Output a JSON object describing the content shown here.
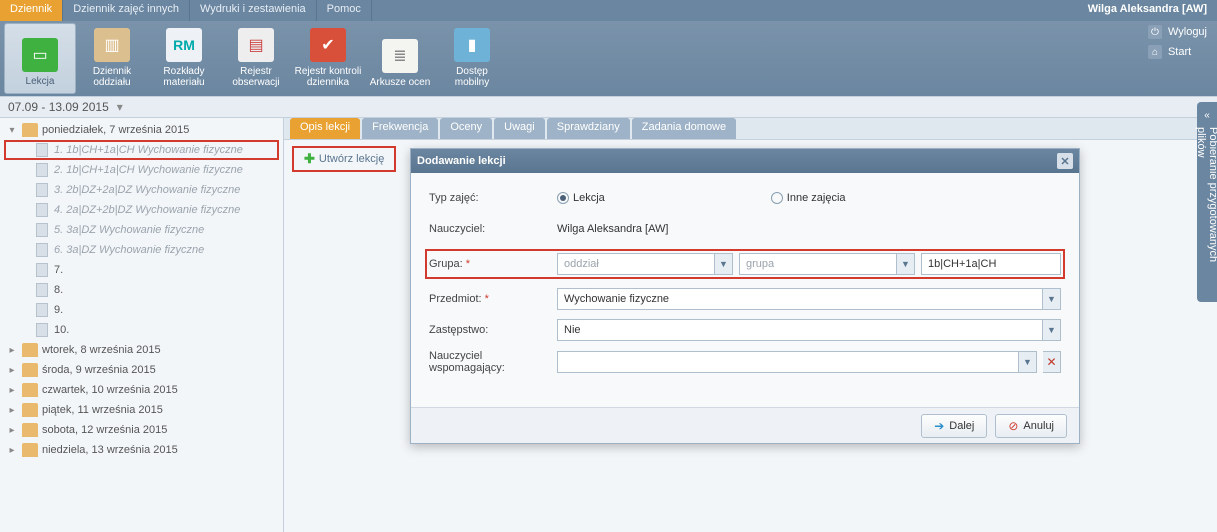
{
  "menubar": {
    "tabs": [
      "Dziennik",
      "Dziennik zajęć innych",
      "Wydruki i zestawienia",
      "Pomoc"
    ],
    "active_index": 0,
    "user": "Wilga Aleksandra [AW]"
  },
  "ribbon": {
    "items": [
      {
        "label": "Lekcja"
      },
      {
        "label": "Dziennik oddziału"
      },
      {
        "label": "Rozkłady materiału"
      },
      {
        "label": "Rejestr obserwacji"
      },
      {
        "label": "Rejestr kontroli dziennika"
      },
      {
        "label": "Arkusze ocen"
      },
      {
        "label": "Dostęp mobilny"
      }
    ],
    "active_index": 0,
    "links": {
      "logout": "Wyloguj",
      "start": "Start"
    }
  },
  "date_range": "07.09 - 13.09 2015",
  "sidebar": {
    "days": [
      {
        "label": "poniedziałek, 7 września 2015",
        "expanded": true,
        "lessons": [
          {
            "label": "1. 1b|CH+1a|CH Wychowanie fizyczne",
            "dim": true,
            "selected": true
          },
          {
            "label": "2. 1b|CH+1a|CH Wychowanie fizyczne",
            "dim": true
          },
          {
            "label": "3. 2b|DZ+2a|DZ Wychowanie fizyczne",
            "dim": true
          },
          {
            "label": "4. 2a|DZ+2b|DZ Wychowanie fizyczne",
            "dim": true
          },
          {
            "label": "5. 3a|DZ Wychowanie fizyczne",
            "dim": true
          },
          {
            "label": "6. 3a|DZ Wychowanie fizyczne",
            "dim": true
          },
          {
            "label": "7.",
            "dim": false
          },
          {
            "label": "8.",
            "dim": false
          },
          {
            "label": "9.",
            "dim": false
          },
          {
            "label": "10.",
            "dim": false
          }
        ]
      },
      {
        "label": "wtorek, 8 września 2015"
      },
      {
        "label": "środa, 9 września 2015"
      },
      {
        "label": "czwartek, 10 września 2015"
      },
      {
        "label": "piątek, 11 września 2015"
      },
      {
        "label": "sobota, 12 września 2015"
      },
      {
        "label": "niedziela, 13 września 2015"
      }
    ]
  },
  "inner_tabs": [
    "Opis lekcji",
    "Frekwencja",
    "Oceny",
    "Uwagi",
    "Sprawdziany",
    "Zadania domowe"
  ],
  "inner_tabs_active": 0,
  "create_lesson_label": "Utwórz lekcję",
  "dialog": {
    "title": "Dodawanie lekcji",
    "labels": {
      "typ": "Typ zajęć:",
      "radio_lekcja": "Lekcja",
      "radio_inne": "Inne zajęcia",
      "nauczyciel": "Nauczyciel:",
      "grupa": "Grupa:",
      "przedmiot": "Przedmiot:",
      "zastepstwo": "Zastępstwo:",
      "wspomagajacy": "Nauczyciel wspomagający:"
    },
    "values": {
      "nauczyciel": "Wilga Aleksandra [AW]",
      "oddzial_placeholder": "oddział",
      "grupa_placeholder": "grupa",
      "grupa_text": "1b|CH+1a|CH",
      "przedmiot": "Wychowanie fizyczne",
      "zastepstwo": "Nie",
      "wspomagajacy": ""
    },
    "buttons": {
      "next": "Dalej",
      "cancel": "Anuluj"
    }
  },
  "vtab_label": "Pobieranie przygotowanych plików"
}
